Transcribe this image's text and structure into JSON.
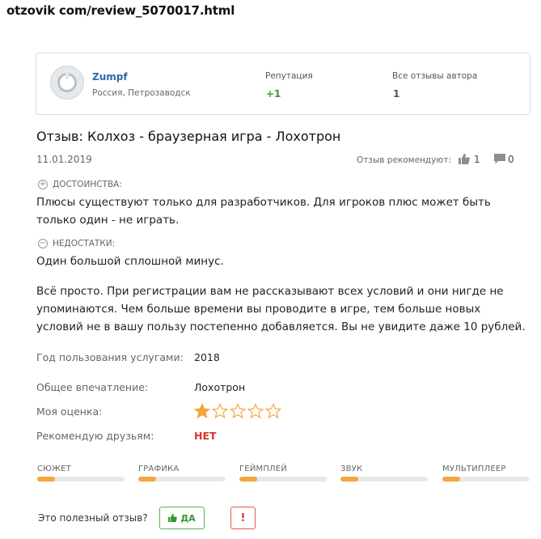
{
  "url": "otzovik com/review_5070017.html",
  "author": {
    "name": "Zumpf",
    "location": "Россия, Петрозаводск",
    "reputation_label": "Репутация",
    "reputation_value": "+1",
    "reviews_label": "Все отзывы автора",
    "reviews_value": "1"
  },
  "review": {
    "title": "Отзыв: Колхоз - браузерная игра - Лохотрон",
    "date": "11.01.2019",
    "recommend_label": "Отзыв рекомендуют:",
    "recommend_count": "1",
    "comments_count": "0",
    "pros_label": "ДОСТОИНСТВА:",
    "pros_text": "Плюсы существуют только для разработчиков. Для игроков плюс может быть только один - не играть.",
    "cons_label": "НЕДОСТАТКИ:",
    "cons_text": "Один большой сплошной минус.",
    "body_text": "Всё просто. При регистрации вам не рассказывают всех условий и они нигде не упоминаются. Чем больше времени вы проводите в игре, тем больше новых условий не в вашу пользу постепенно добавляется. Вы не увидите даже 10 рублей."
  },
  "details": {
    "year_label": "Год пользования услугами:",
    "year_value": "2018",
    "impression_label": "Общее впечатление:",
    "impression_value": "Лохотрон",
    "rating_label": "Моя оценка:",
    "rating_value": 1,
    "rating_max": 5,
    "recommend_label": "Рекомендую друзьям:",
    "recommend_value": "НЕТ"
  },
  "metrics": [
    {
      "label": "СЮЖЕТ",
      "value": 0.2
    },
    {
      "label": "ГРАФИКА",
      "value": 0.2
    },
    {
      "label": "ГЕЙМПЛЕЙ",
      "value": 0.2
    },
    {
      "label": "ЗВУК",
      "value": 0.2
    },
    {
      "label": "МУЛЬТИПЛЕЕР",
      "value": 0.2
    }
  ],
  "footer": {
    "useful_label": "Это полезный отзыв?",
    "yes_label": "ДА",
    "report_label": "!"
  },
  "colors": {
    "accent_orange": "#f2a73b",
    "link_blue": "#2b6aa6",
    "positive_green": "#2f9a2f",
    "negative_red": "#d9352a"
  }
}
